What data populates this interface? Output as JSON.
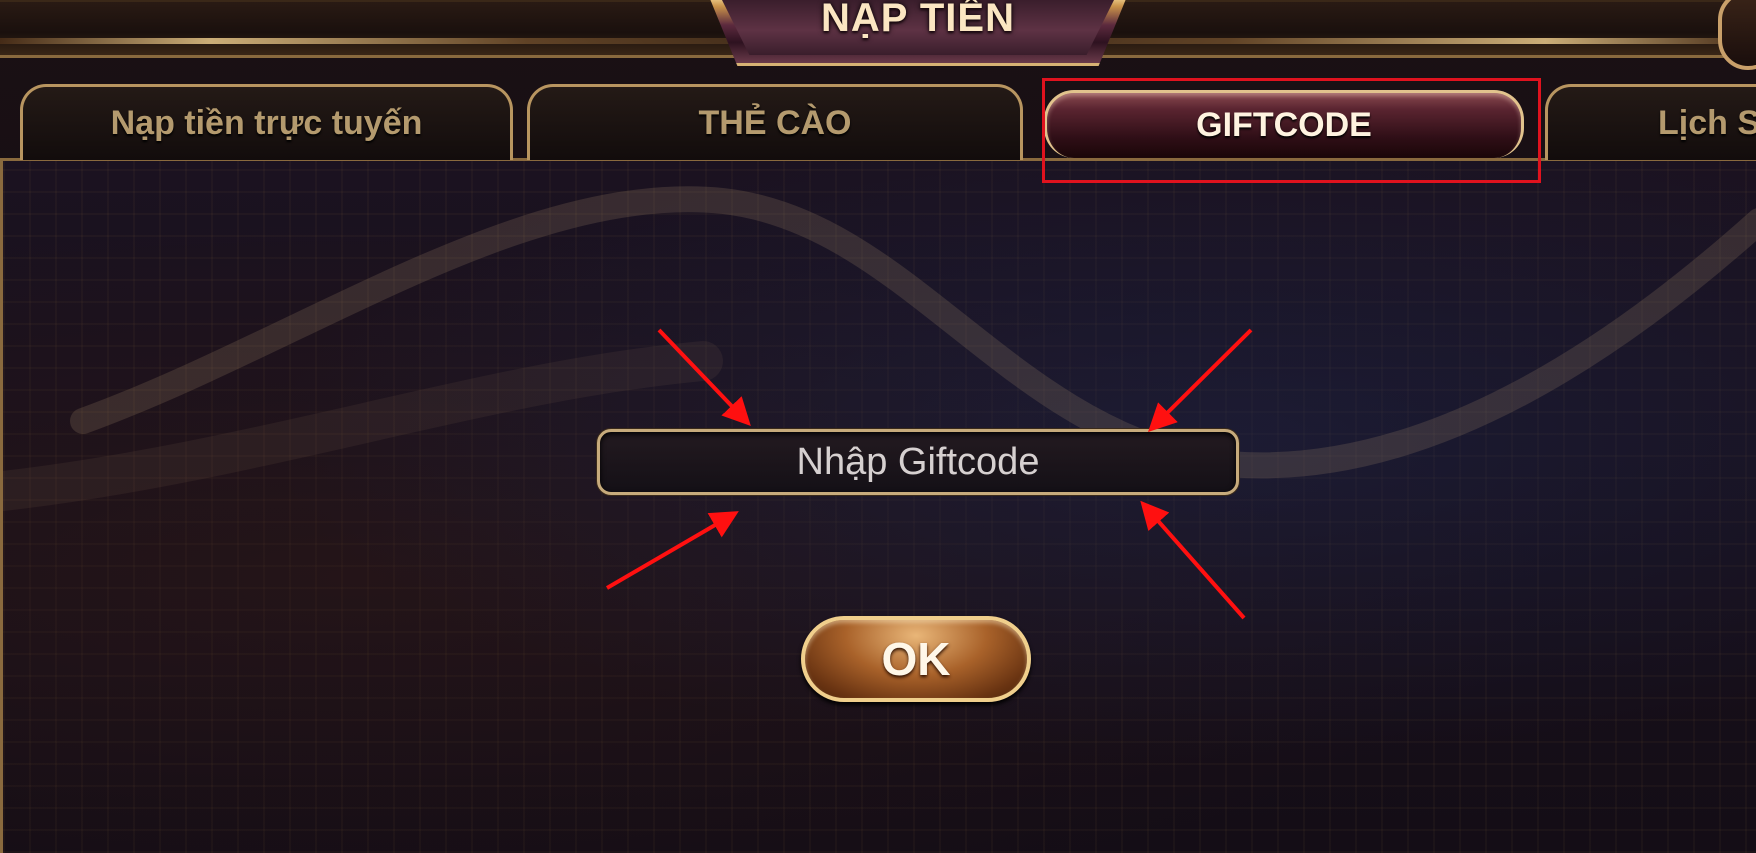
{
  "header": {
    "title": "NẠP TIỀN"
  },
  "tabs": [
    {
      "label": "Nạp tiền trực tuyến",
      "active": false
    },
    {
      "label": "THẺ CÀO",
      "active": false
    },
    {
      "label": "GIFTCODE",
      "active": true
    },
    {
      "label": "Lịch S",
      "active": false
    }
  ],
  "giftcode_form": {
    "input_value": "",
    "input_placeholder": "Nhập Giftcode",
    "submit_label": "OK"
  },
  "annotations": {
    "highlight_color": "#e0121e",
    "arrow_color": "#ff1010"
  },
  "colors": {
    "gold": "#c7ab7c",
    "active_tab": "#5a2430",
    "ok_button": "#a9622a"
  }
}
